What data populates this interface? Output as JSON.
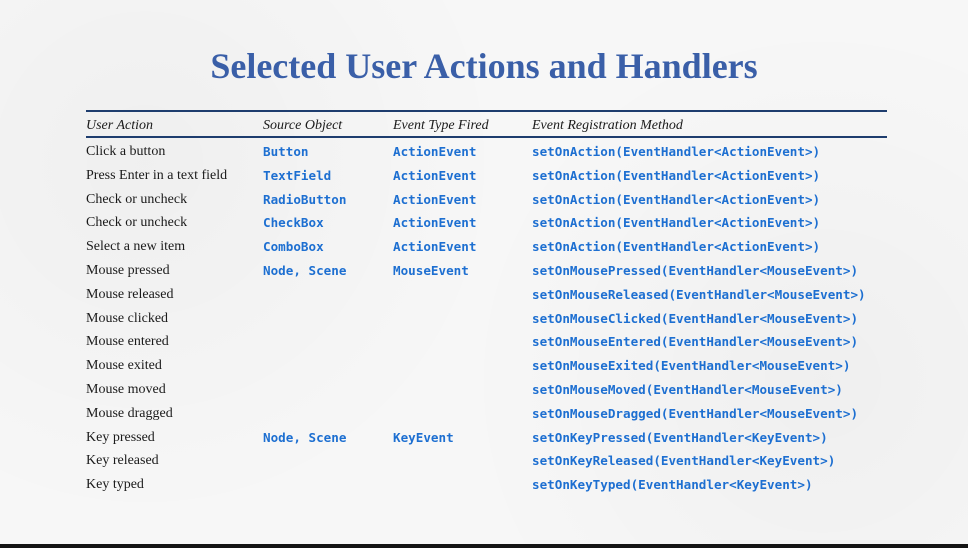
{
  "title": "Selected User Actions and Handlers",
  "columns": [
    "User Action",
    "Source Object",
    "Event Type Fired",
    "Event Registration Method"
  ],
  "rows": [
    {
      "action": "Click a button",
      "source": "Button",
      "event": "ActionEvent",
      "method": "setOnAction(EventHandler<ActionEvent>)"
    },
    {
      "action": "Press Enter in a text field",
      "source": "TextField",
      "event": "ActionEvent",
      "method": "setOnAction(EventHandler<ActionEvent>)"
    },
    {
      "action": "Check or uncheck",
      "source": "RadioButton",
      "event": "ActionEvent",
      "method": "setOnAction(EventHandler<ActionEvent>)"
    },
    {
      "action": "Check or uncheck",
      "source": "CheckBox",
      "event": "ActionEvent",
      "method": "setOnAction(EventHandler<ActionEvent>)"
    },
    {
      "action": "Select a new item",
      "source": "ComboBox",
      "event": "ActionEvent",
      "method": "setOnAction(EventHandler<ActionEvent>)"
    },
    {
      "action": "Mouse pressed",
      "source": "Node, Scene",
      "event": "MouseEvent",
      "method": "setOnMousePressed(EventHandler<MouseEvent>)"
    },
    {
      "action": "Mouse released",
      "source": "",
      "event": "",
      "method": "setOnMouseReleased(EventHandler<MouseEvent>)"
    },
    {
      "action": "Mouse clicked",
      "source": "",
      "event": "",
      "method": "setOnMouseClicked(EventHandler<MouseEvent>)"
    },
    {
      "action": "Mouse entered",
      "source": "",
      "event": "",
      "method": "setOnMouseEntered(EventHandler<MouseEvent>)"
    },
    {
      "action": "Mouse exited",
      "source": "",
      "event": "",
      "method": "setOnMouseExited(EventHandler<MouseEvent>)"
    },
    {
      "action": "Mouse moved",
      "source": "",
      "event": "",
      "method": "setOnMouseMoved(EventHandler<MouseEvent>)"
    },
    {
      "action": "Mouse dragged",
      "source": "",
      "event": "",
      "method": "setOnMouseDragged(EventHandler<MouseEvent>)"
    },
    {
      "action": "Key pressed",
      "source": "Node, Scene",
      "event": "KeyEvent",
      "method": "setOnKeyPressed(EventHandler<KeyEvent>)"
    },
    {
      "action": "Key released",
      "source": "",
      "event": "",
      "method": "setOnKeyReleased(EventHandler<KeyEvent>)"
    },
    {
      "action": "Key typed",
      "source": "",
      "event": "",
      "method": "setOnKeyTyped(EventHandler<KeyEvent>)"
    }
  ],
  "colors": {
    "title": "#3a5fa8",
    "code": "#1d6fd1",
    "rule": "#1e3d6e"
  }
}
